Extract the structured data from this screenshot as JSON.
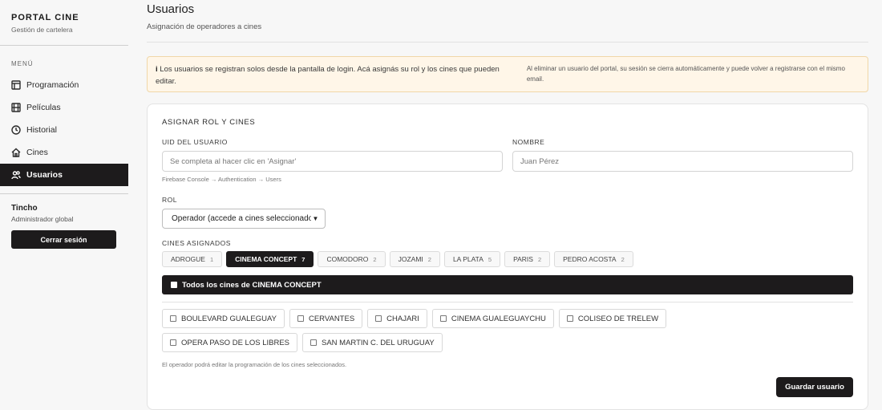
{
  "sidebar": {
    "title": "PORTAL CINE",
    "subtitle": "Gestión de cartelera",
    "menu_label": "MENÚ",
    "items": [
      {
        "label": "Programación",
        "icon": "layout-icon"
      },
      {
        "label": "Películas",
        "icon": "film-icon"
      },
      {
        "label": "Historial",
        "icon": "clock-icon"
      },
      {
        "label": "Cines",
        "icon": "home-icon"
      },
      {
        "label": "Usuarios",
        "icon": "users-icon",
        "active": true
      }
    ],
    "user": {
      "name": "Tincho",
      "role": "Administrador global",
      "logout_label": "Cerrar sesión"
    }
  },
  "page": {
    "title": "Usuarios",
    "subtitle": "Asignación de operadores a cines"
  },
  "notice": {
    "icon": "i",
    "main": "Los usuarios se registran solos desde la pantalla de login. Acá asignás su rol y los cines que pueden editar.",
    "side": "Al eliminar un usuario del portal, su sesión se cierra automáticamente y puede volver a registrarse con el mismo email."
  },
  "form": {
    "title": "ASIGNAR ROL Y CINES",
    "uid_label": "UID DEL USUARIO",
    "uid_placeholder": "Se completa al hacer clic en 'Asignar'",
    "uid_hint": "Firebase Console → Authentication → Users",
    "name_label": "NOMBRE",
    "name_placeholder": "Juan Pérez",
    "role_label": "ROL",
    "role_value": "Operador (accede a cines seleccionados)",
    "cines_label": "CINES ASIGNADOS",
    "chains": [
      {
        "name": "ADROGUE",
        "count": "1"
      },
      {
        "name": "CINEMA CONCEPT",
        "count": "7",
        "active": true
      },
      {
        "name": "COMODORO",
        "count": "2"
      },
      {
        "name": "JOZAMI",
        "count": "2"
      },
      {
        "name": "LA PLATA",
        "count": "5"
      },
      {
        "name": "PARIS",
        "count": "2"
      },
      {
        "name": "PEDRO ACOSTA",
        "count": "2"
      }
    ],
    "all_label": "Todos los cines de CINEMA CONCEPT",
    "cinemas": [
      "BOULEVARD GUALEGUAY",
      "CERVANTES",
      "CHAJARI",
      "CINEMA GUALEGUAYCHU",
      "COLISEO DE TRELEW",
      "OPERA PASO DE LOS LIBRES",
      "SAN MARTIN C. DEL URUGUAY"
    ],
    "footer_hint": "El operador podrá editar la programación de los cines seleccionados.",
    "save_label": "Guardar usuario"
  }
}
